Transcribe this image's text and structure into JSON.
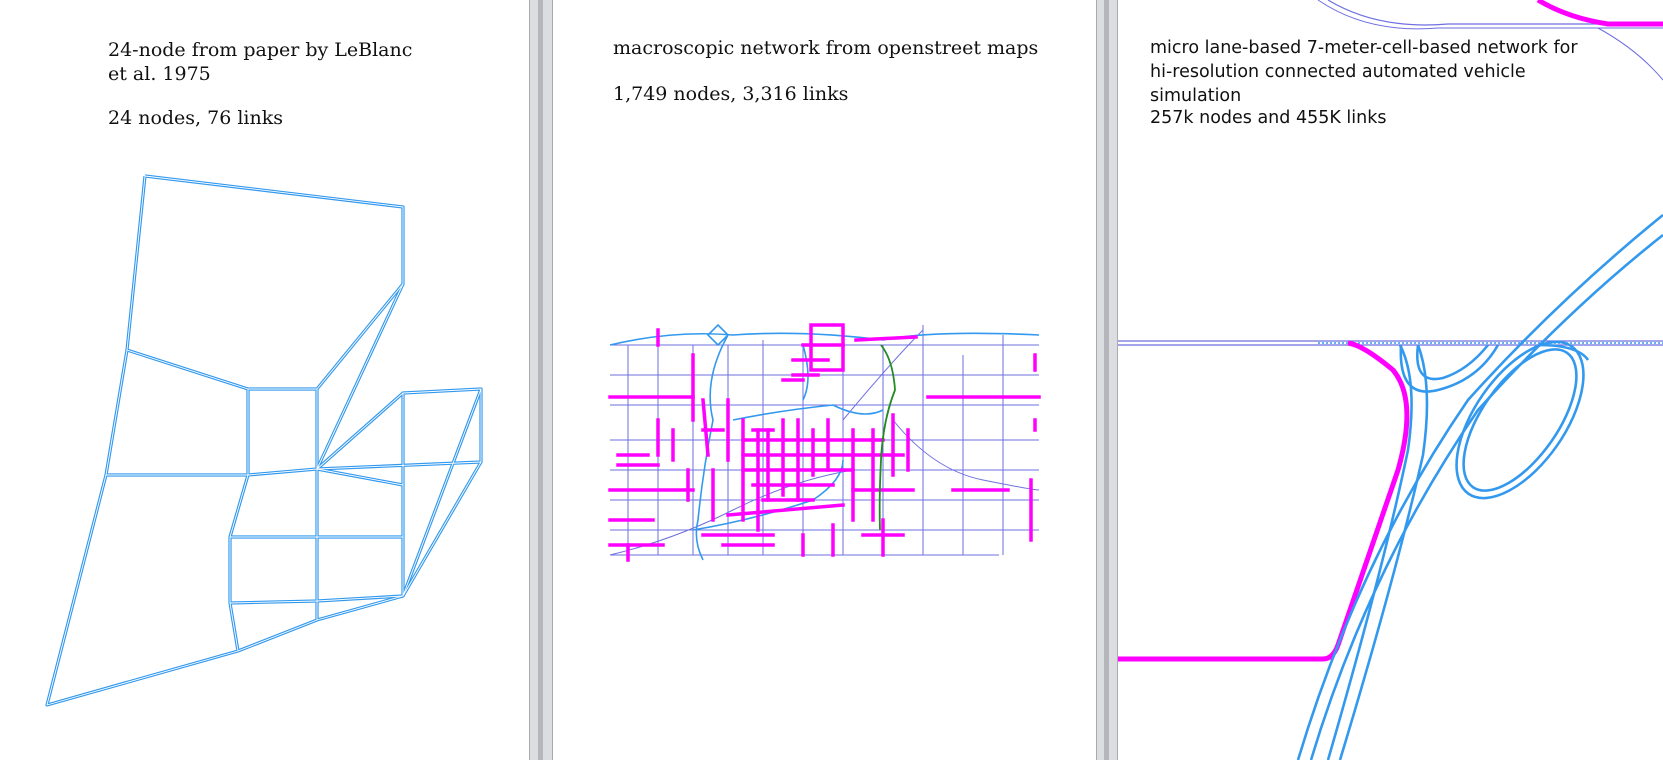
{
  "panels": [
    {
      "title": "24-node from paper by LeBlanc et al. 1975",
      "stats": "24 nodes, 76 links"
    },
    {
      "title": "macroscopic network from openstreet maps",
      "stats": "1,749 nodes, 3,316 links"
    },
    {
      "title": "micro lane-based 7-meter-cell-based network for hi-resolution connected automated vehicle simulation",
      "stats": "257k nodes and 455K links"
    }
  ],
  "colors": {
    "link_blue": "#3399ee",
    "major_magenta": "#ff00ff",
    "minor_link": "#6f6fe0",
    "highlight_green": "#228b22",
    "splitter": "#dcdde0"
  }
}
